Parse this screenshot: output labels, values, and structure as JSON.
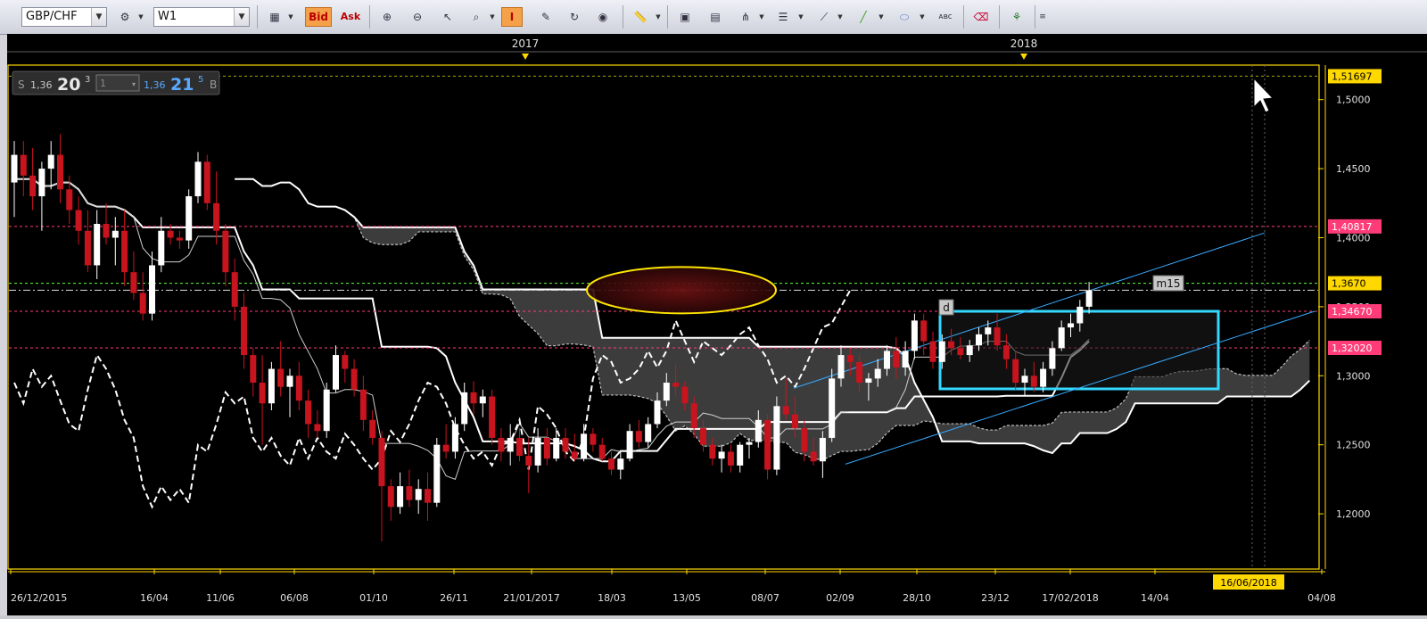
{
  "toolbar": {
    "symbol": "GBP/CHF",
    "timeframe": "W1",
    "bid_label": "Bid",
    "ask_label": "Ask",
    "icons": [
      "crosshair-icon",
      "chart-type-icon",
      "zoom-in-icon",
      "zoom-out-icon",
      "cursor-icon",
      "magnifier-icon",
      "period-separator-icon",
      "edit-icon",
      "refresh-icon",
      "globe-icon",
      "ruler-icon",
      "image-icon",
      "template-icon",
      "pitchfork-icon",
      "horizontal-lines-icon",
      "fan-icon",
      "trendline-icon",
      "ellipse-icon",
      "text-label-icon",
      "eraser-icon",
      "network-icon",
      "grid-icon"
    ]
  },
  "quote": {
    "sell_label": "S",
    "sell_big": "1,36",
    "sell_pips": "20",
    "sell_sup": "3",
    "lot": "1",
    "buy_big": "1,36",
    "buy_pips": "21",
    "buy_sup": "5",
    "buy_label": "B"
  },
  "colors": {
    "accent_yellow": "#ffd800",
    "bull": "#ffffff",
    "bear": "#c8141e",
    "level_red": "#ff3c78",
    "box": "#35d8ff",
    "channel": "#36a9ff",
    "cloud": "#464646"
  },
  "chart_data": {
    "type": "candlestick",
    "symbol": "GBP/CHF",
    "timeframe": "W1",
    "ylim": [
      1.16,
      1.525
    ],
    "x_tick_labels": [
      "26/12/2015",
      "16/04",
      "11/06",
      "06/08",
      "01/10",
      "26/11",
      "21/01/2017",
      "18/03",
      "13/05",
      "08/07",
      "02/09",
      "28/10",
      "23/12",
      "17/02/2018",
      "14/04",
      "16/06/2018",
      "04/08"
    ],
    "year_labels": [
      "2017",
      "2018"
    ],
    "y_tick_labels": [
      "1,5000",
      "1,4500",
      "1,4000",
      "1,3500",
      "1,3000",
      "1,2500",
      "1,2000"
    ],
    "y_ticks": [
      1.5,
      1.45,
      1.4,
      1.35,
      1.3,
      1.25,
      1.2
    ],
    "price_levels": [
      {
        "label": "1,51697",
        "value": 1.51697,
        "kind": "yellow"
      },
      {
        "label": "1,40817",
        "value": 1.40817,
        "kind": "red"
      },
      {
        "label": "1,3670",
        "value": 1.367,
        "kind": "highlight"
      },
      {
        "label": "1,34670",
        "value": 1.3467,
        "kind": "red"
      },
      {
        "label": "1,32020",
        "value": 1.3202,
        "kind": "red"
      }
    ],
    "annotations": [
      {
        "text": "d"
      },
      {
        "text": "m15"
      }
    ],
    "candles": [
      {
        "o": 1.44,
        "h": 1.47,
        "l": 1.415,
        "c": 1.46
      },
      {
        "o": 1.46,
        "h": 1.47,
        "l": 1.43,
        "c": 1.445
      },
      {
        "o": 1.445,
        "h": 1.465,
        "l": 1.42,
        "c": 1.43
      },
      {
        "o": 1.43,
        "h": 1.455,
        "l": 1.405,
        "c": 1.45
      },
      {
        "o": 1.45,
        "h": 1.47,
        "l": 1.435,
        "c": 1.46
      },
      {
        "o": 1.46,
        "h": 1.475,
        "l": 1.425,
        "c": 1.435
      },
      {
        "o": 1.435,
        "h": 1.445,
        "l": 1.41,
        "c": 1.42
      },
      {
        "o": 1.42,
        "h": 1.43,
        "l": 1.395,
        "c": 1.405
      },
      {
        "o": 1.405,
        "h": 1.42,
        "l": 1.375,
        "c": 1.38
      },
      {
        "o": 1.38,
        "h": 1.42,
        "l": 1.37,
        "c": 1.41
      },
      {
        "o": 1.41,
        "h": 1.425,
        "l": 1.395,
        "c": 1.4
      },
      {
        "o": 1.4,
        "h": 1.415,
        "l": 1.38,
        "c": 1.405
      },
      {
        "o": 1.405,
        "h": 1.42,
        "l": 1.365,
        "c": 1.375
      },
      {
        "o": 1.375,
        "h": 1.39,
        "l": 1.355,
        "c": 1.36
      },
      {
        "o": 1.36,
        "h": 1.375,
        "l": 1.34,
        "c": 1.345
      },
      {
        "o": 1.345,
        "h": 1.39,
        "l": 1.34,
        "c": 1.38
      },
      {
        "o": 1.38,
        "h": 1.415,
        "l": 1.375,
        "c": 1.405
      },
      {
        "o": 1.405,
        "h": 1.41,
        "l": 1.395,
        "c": 1.4
      },
      {
        "o": 1.4,
        "h": 1.405,
        "l": 1.392,
        "c": 1.398
      },
      {
        "o": 1.398,
        "h": 1.435,
        "l": 1.392,
        "c": 1.43
      },
      {
        "o": 1.43,
        "h": 1.462,
        "l": 1.425,
        "c": 1.455
      },
      {
        "o": 1.455,
        "h": 1.46,
        "l": 1.42,
        "c": 1.425
      },
      {
        "o": 1.425,
        "h": 1.448,
        "l": 1.395,
        "c": 1.405
      },
      {
        "o": 1.405,
        "h": 1.41,
        "l": 1.365,
        "c": 1.375
      },
      {
        "o": 1.375,
        "h": 1.385,
        "l": 1.34,
        "c": 1.35
      },
      {
        "o": 1.35,
        "h": 1.36,
        "l": 1.305,
        "c": 1.315
      },
      {
        "o": 1.315,
        "h": 1.32,
        "l": 1.285,
        "c": 1.295
      },
      {
        "o": 1.295,
        "h": 1.315,
        "l": 1.25,
        "c": 1.28
      },
      {
        "o": 1.28,
        "h": 1.31,
        "l": 1.275,
        "c": 1.305
      },
      {
        "o": 1.305,
        "h": 1.325,
        "l": 1.285,
        "c": 1.292
      },
      {
        "o": 1.292,
        "h": 1.305,
        "l": 1.27,
        "c": 1.3
      },
      {
        "o": 1.3,
        "h": 1.31,
        "l": 1.275,
        "c": 1.282
      },
      {
        "o": 1.282,
        "h": 1.29,
        "l": 1.255,
        "c": 1.265
      },
      {
        "o": 1.265,
        "h": 1.275,
        "l": 1.255,
        "c": 1.26
      },
      {
        "o": 1.26,
        "h": 1.295,
        "l": 1.255,
        "c": 1.29
      },
      {
        "o": 1.29,
        "h": 1.322,
        "l": 1.288,
        "c": 1.315
      },
      {
        "o": 1.315,
        "h": 1.318,
        "l": 1.295,
        "c": 1.305
      },
      {
        "o": 1.305,
        "h": 1.312,
        "l": 1.285,
        "c": 1.29
      },
      {
        "o": 1.29,
        "h": 1.3,
        "l": 1.26,
        "c": 1.268
      },
      {
        "o": 1.268,
        "h": 1.275,
        "l": 1.25,
        "c": 1.255
      },
      {
        "o": 1.255,
        "h": 1.26,
        "l": 1.18,
        "c": 1.22
      },
      {
        "o": 1.22,
        "h": 1.225,
        "l": 1.195,
        "c": 1.205
      },
      {
        "o": 1.205,
        "h": 1.23,
        "l": 1.2,
        "c": 1.22
      },
      {
        "o": 1.22,
        "h": 1.232,
        "l": 1.205,
        "c": 1.21
      },
      {
        "o": 1.21,
        "h": 1.225,
        "l": 1.2,
        "c": 1.218
      },
      {
        "o": 1.218,
        "h": 1.23,
        "l": 1.195,
        "c": 1.208
      },
      {
        "o": 1.208,
        "h": 1.255,
        "l": 1.205,
        "c": 1.25
      },
      {
        "o": 1.25,
        "h": 1.265,
        "l": 1.24,
        "c": 1.245
      },
      {
        "o": 1.245,
        "h": 1.27,
        "l": 1.24,
        "c": 1.265
      },
      {
        "o": 1.265,
        "h": 1.295,
        "l": 1.26,
        "c": 1.288
      },
      {
        "o": 1.288,
        "h": 1.296,
        "l": 1.272,
        "c": 1.28
      },
      {
        "o": 1.28,
        "h": 1.29,
        "l": 1.27,
        "c": 1.285
      },
      {
        "o": 1.285,
        "h": 1.29,
        "l": 1.25,
        "c": 1.255
      },
      {
        "o": 1.255,
        "h": 1.262,
        "l": 1.238,
        "c": 1.245
      },
      {
        "o": 1.245,
        "h": 1.265,
        "l": 1.235,
        "c": 1.255
      },
      {
        "o": 1.255,
        "h": 1.262,
        "l": 1.238,
        "c": 1.242
      },
      {
        "o": 1.242,
        "h": 1.255,
        "l": 1.215,
        "c": 1.235
      },
      {
        "o": 1.235,
        "h": 1.262,
        "l": 1.23,
        "c": 1.255
      },
      {
        "o": 1.255,
        "h": 1.262,
        "l": 1.235,
        "c": 1.24
      },
      {
        "o": 1.24,
        "h": 1.262,
        "l": 1.238,
        "c": 1.255
      },
      {
        "o": 1.255,
        "h": 1.262,
        "l": 1.24,
        "c": 1.245
      },
      {
        "o": 1.245,
        "h": 1.258,
        "l": 1.238,
        "c": 1.24
      },
      {
        "o": 1.24,
        "h": 1.265,
        "l": 1.238,
        "c": 1.258
      },
      {
        "o": 1.258,
        "h": 1.262,
        "l": 1.245,
        "c": 1.25
      },
      {
        "o": 1.25,
        "h": 1.255,
        "l": 1.238,
        "c": 1.24
      },
      {
        "o": 1.24,
        "h": 1.245,
        "l": 1.228,
        "c": 1.232
      },
      {
        "o": 1.232,
        "h": 1.245,
        "l": 1.225,
        "c": 1.24
      },
      {
        "o": 1.24,
        "h": 1.265,
        "l": 1.238,
        "c": 1.26
      },
      {
        "o": 1.26,
        "h": 1.268,
        "l": 1.248,
        "c": 1.252
      },
      {
        "o": 1.252,
        "h": 1.27,
        "l": 1.248,
        "c": 1.265
      },
      {
        "o": 1.265,
        "h": 1.288,
        "l": 1.262,
        "c": 1.282
      },
      {
        "o": 1.282,
        "h": 1.302,
        "l": 1.278,
        "c": 1.295
      },
      {
        "o": 1.295,
        "h": 1.308,
        "l": 1.285,
        "c": 1.292
      },
      {
        "o": 1.292,
        "h": 1.296,
        "l": 1.275,
        "c": 1.28
      },
      {
        "o": 1.28,
        "h": 1.285,
        "l": 1.255,
        "c": 1.262
      },
      {
        "o": 1.262,
        "h": 1.268,
        "l": 1.245,
        "c": 1.25
      },
      {
        "o": 1.25,
        "h": 1.255,
        "l": 1.235,
        "c": 1.24
      },
      {
        "o": 1.24,
        "h": 1.25,
        "l": 1.23,
        "c": 1.245
      },
      {
        "o": 1.245,
        "h": 1.25,
        "l": 1.23,
        "c": 1.235
      },
      {
        "o": 1.235,
        "h": 1.252,
        "l": 1.23,
        "c": 1.25
      },
      {
        "o": 1.25,
        "h": 1.255,
        "l": 1.24,
        "c": 1.252
      },
      {
        "o": 1.252,
        "h": 1.275,
        "l": 1.248,
        "c": 1.268
      },
      {
        "o": 1.268,
        "h": 1.272,
        "l": 1.225,
        "c": 1.232
      },
      {
        "o": 1.232,
        "h": 1.285,
        "l": 1.228,
        "c": 1.278
      },
      {
        "o": 1.278,
        "h": 1.298,
        "l": 1.268,
        "c": 1.272
      },
      {
        "o": 1.272,
        "h": 1.285,
        "l": 1.255,
        "c": 1.262
      },
      {
        "o": 1.262,
        "h": 1.268,
        "l": 1.238,
        "c": 1.245
      },
      {
        "o": 1.245,
        "h": 1.255,
        "l": 1.235,
        "c": 1.238
      },
      {
        "o": 1.238,
        "h": 1.26,
        "l": 1.226,
        "c": 1.255
      },
      {
        "o": 1.255,
        "h": 1.305,
        "l": 1.252,
        "c": 1.298
      },
      {
        "o": 1.298,
        "h": 1.322,
        "l": 1.292,
        "c": 1.315
      },
      {
        "o": 1.315,
        "h": 1.32,
        "l": 1.3,
        "c": 1.31
      },
      {
        "o": 1.31,
        "h": 1.315,
        "l": 1.288,
        "c": 1.295
      },
      {
        "o": 1.295,
        "h": 1.302,
        "l": 1.282,
        "c": 1.298
      },
      {
        "o": 1.298,
        "h": 1.312,
        "l": 1.292,
        "c": 1.305
      },
      {
        "o": 1.305,
        "h": 1.322,
        "l": 1.3,
        "c": 1.318
      },
      {
        "o": 1.318,
        "h": 1.328,
        "l": 1.298,
        "c": 1.306
      },
      {
        "o": 1.306,
        "h": 1.325,
        "l": 1.3,
        "c": 1.318
      },
      {
        "o": 1.318,
        "h": 1.345,
        "l": 1.312,
        "c": 1.34
      },
      {
        "o": 1.34,
        "h": 1.345,
        "l": 1.315,
        "c": 1.325
      },
      {
        "o": 1.325,
        "h": 1.332,
        "l": 1.305,
        "c": 1.31
      },
      {
        "o": 1.31,
        "h": 1.33,
        "l": 1.305,
        "c": 1.325
      },
      {
        "o": 1.325,
        "h": 1.334,
        "l": 1.315,
        "c": 1.32
      },
      {
        "o": 1.32,
        "h": 1.328,
        "l": 1.312,
        "c": 1.315
      },
      {
        "o": 1.315,
        "h": 1.326,
        "l": 1.31,
        "c": 1.322
      },
      {
        "o": 1.322,
        "h": 1.335,
        "l": 1.318,
        "c": 1.33
      },
      {
        "o": 1.33,
        "h": 1.34,
        "l": 1.322,
        "c": 1.335
      },
      {
        "o": 1.335,
        "h": 1.345,
        "l": 1.318,
        "c": 1.322
      },
      {
        "o": 1.322,
        "h": 1.33,
        "l": 1.305,
        "c": 1.312
      },
      {
        "o": 1.312,
        "h": 1.318,
        "l": 1.29,
        "c": 1.295
      },
      {
        "o": 1.295,
        "h": 1.305,
        "l": 1.285,
        "c": 1.3
      },
      {
        "o": 1.3,
        "h": 1.31,
        "l": 1.288,
        "c": 1.292
      },
      {
        "o": 1.292,
        "h": 1.31,
        "l": 1.288,
        "c": 1.305
      },
      {
        "o": 1.305,
        "h": 1.325,
        "l": 1.3,
        "c": 1.32
      },
      {
        "o": 1.32,
        "h": 1.34,
        "l": 1.318,
        "c": 1.335
      },
      {
        "o": 1.335,
        "h": 1.345,
        "l": 1.328,
        "c": 1.338
      },
      {
        "o": 1.338,
        "h": 1.355,
        "l": 1.332,
        "c": 1.35
      },
      {
        "o": 1.35,
        "h": 1.368,
        "l": 1.345,
        "c": 1.362
      }
    ]
  }
}
